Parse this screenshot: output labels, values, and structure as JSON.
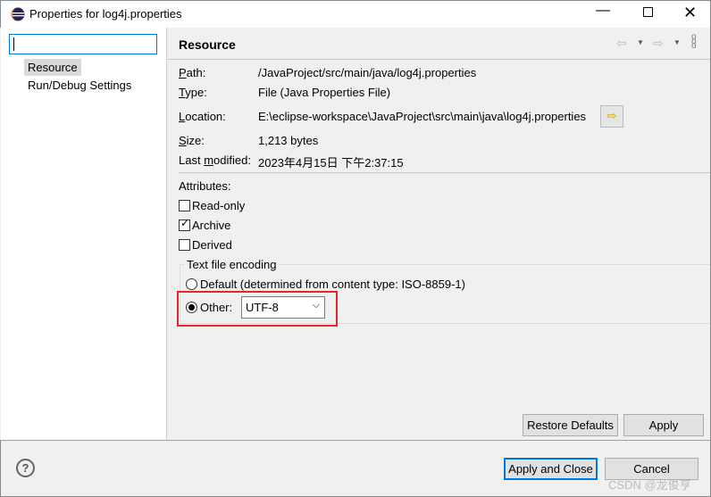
{
  "window": {
    "title": "Properties for log4j.properties"
  },
  "sidebar": {
    "filter_value": "",
    "items": [
      {
        "label": "Resource",
        "selected": true
      },
      {
        "label": "Run/Debug Settings",
        "selected": false
      }
    ]
  },
  "page": {
    "title": "Resource",
    "path_label": "Path:",
    "path": "/JavaProject/src/main/java/log4j.properties",
    "type_label": "Type:",
    "type": "File  (Java Properties File)",
    "location_label": "Location:",
    "location": "E:\\eclipse-workspace\\JavaProject\\src\\main\\java\\log4j.properties",
    "size_label": "Size:",
    "size": "1,213  bytes",
    "modified_label": "Last modified:",
    "modified": "2023年4月15日 下午2:37:15",
    "attributes_label": "Attributes:",
    "read_only": {
      "label": "Read-only",
      "checked": false
    },
    "archive": {
      "label": "Archive",
      "checked": true
    },
    "derived": {
      "label": "Derived",
      "checked": false
    },
    "encoding": {
      "group_label": "Text file encoding",
      "default_label": "Default (determined from content type: ISO-8859-1)",
      "other_label": "Other:",
      "selected": "other",
      "value": "UTF-8"
    },
    "restore_defaults": "Restore Defaults",
    "apply": "Apply"
  },
  "footer": {
    "apply_close": "Apply and Close",
    "cancel": "Cancel"
  },
  "watermark": "CSDN @龙俊亨",
  "colors": {
    "highlight": "#e8262a",
    "focus": "#0078d7"
  }
}
